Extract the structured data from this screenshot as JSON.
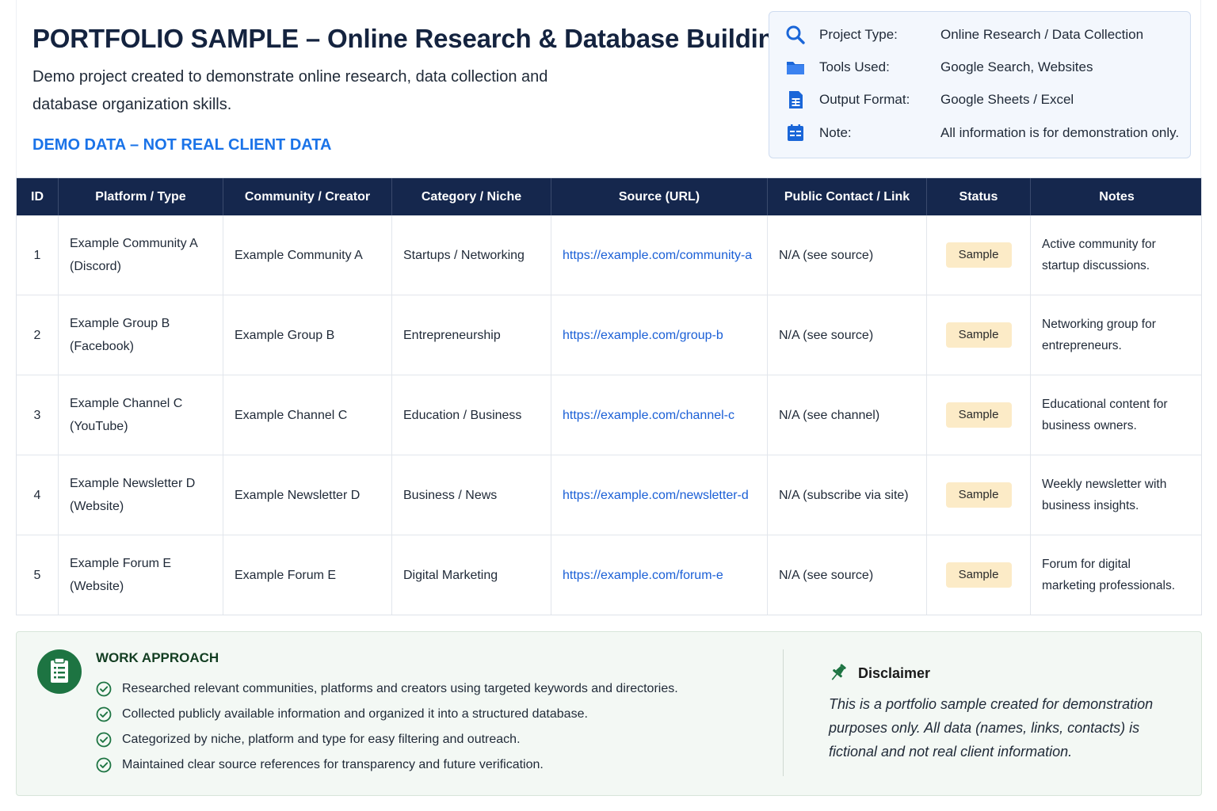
{
  "header": {
    "title": "PORTFOLIO SAMPLE – Online Research & Database Building",
    "subtitle": "Demo project created to demonstrate online research, data collection and database organization skills.",
    "demo_label": "DEMO DATA – NOT REAL CLIENT DATA"
  },
  "info": [
    {
      "icon": "search-icon",
      "label": "Project Type:",
      "value": "Online Research / Data Collection"
    },
    {
      "icon": "folder-icon",
      "label": "Tools Used:",
      "value": "Google Search, Websites"
    },
    {
      "icon": "sheet-icon",
      "label": "Output Format:",
      "value": "Google Sheets / Excel"
    },
    {
      "icon": "note-icon",
      "label": "Note:",
      "value": "All information is for demonstration only."
    }
  ],
  "table": {
    "headers": [
      "ID",
      "Platform / Type",
      "Community / Creator",
      "Category / Niche",
      "Source (URL)",
      "Public Contact / Link",
      "Status",
      "Notes"
    ],
    "rows": [
      {
        "id": "1",
        "platform": "Example Community A (Discord)",
        "creator": "Example Community A",
        "category": "Startups / Networking",
        "url": "https://example.com/community-a",
        "contact": "N/A (see source)",
        "status": "Sample",
        "notes": "Active community for startup discussions."
      },
      {
        "id": "2",
        "platform": "Example Group B (Facebook)",
        "creator": "Example Group B",
        "category": "Entrepreneurship",
        "url": "https://example.com/group-b",
        "contact": "N/A (see source)",
        "status": "Sample",
        "notes": "Networking group for entrepreneurs."
      },
      {
        "id": "3",
        "platform": "Example Channel C (YouTube)",
        "creator": "Example Channel C",
        "category": "Education / Business",
        "url": "https://example.com/channel-c",
        "contact": "N/A (see channel)",
        "status": "Sample",
        "notes": "Educational content for business owners."
      },
      {
        "id": "4",
        "platform": "Example Newsletter D (Website)",
        "creator": "Example Newsletter D",
        "category": "Business / News",
        "url": "https://example.com/newsletter-d",
        "contact": "N/A (subscribe via site)",
        "status": "Sample",
        "notes": "Weekly newsletter with business insights."
      },
      {
        "id": "5",
        "platform": "Example Forum E (Website)",
        "creator": "Example Forum E",
        "category": "Digital Marketing",
        "url": "https://example.com/forum-e",
        "contact": "N/A (see source)",
        "status": "Sample",
        "notes": "Forum for digital marketing professionals."
      }
    ]
  },
  "work_approach": {
    "title": "WORK APPROACH",
    "items": [
      "Researched relevant communities, platforms and creators using targeted keywords and directories.",
      "Collected publicly available information and organized it into a structured database.",
      "Categorized by niche, platform and type for easy filtering and outreach.",
      "Maintained clear source references for transparency and future verification."
    ]
  },
  "disclaimer": {
    "title": "Disclaimer",
    "text": "This is a portfolio sample created for demonstration purposes only. All data (names, links, contacts) is fictional and not real client information."
  },
  "colors": {
    "navy": "#15274d",
    "accent_blue": "#1a73e8",
    "badge": "#fcebc7",
    "green": "#1d7442"
  }
}
